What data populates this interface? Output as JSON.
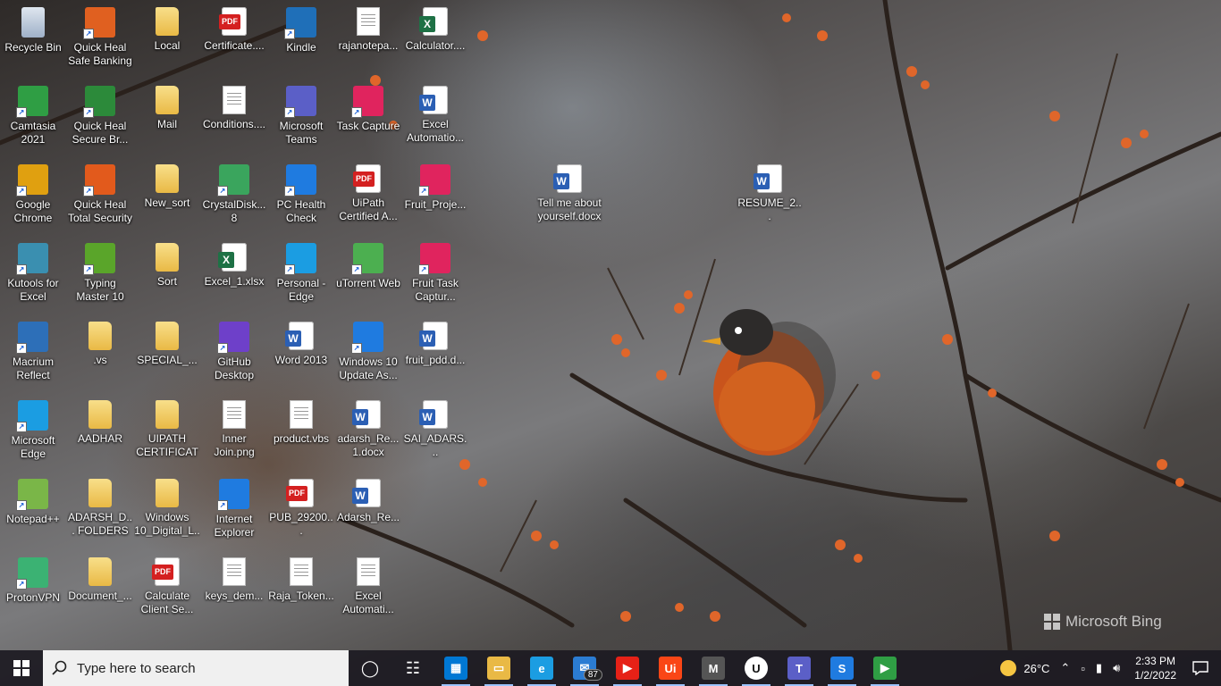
{
  "watermark": "Microsoft Bing",
  "desktop_icons": [
    {
      "label": "Recycle Bin",
      "kind": "recycle",
      "color": "#6a7fa0"
    },
    {
      "label": "Quick Heal Safe Banking",
      "kind": "app",
      "color": "#e06020"
    },
    {
      "label": "Local",
      "kind": "folder"
    },
    {
      "label": "Certificate....",
      "kind": "pdf"
    },
    {
      "label": "Kindle",
      "kind": "app",
      "color": "#1f6fb8"
    },
    {
      "label": "rajanotepa...",
      "kind": "doc"
    },
    {
      "label": "Calculator....",
      "kind": "excel"
    },
    {
      "label": "Camtasia 2021",
      "kind": "app",
      "color": "#2f9e44"
    },
    {
      "label": "Quick Heal Secure Br...",
      "kind": "app",
      "color": "#2c8a3a"
    },
    {
      "label": "Mail",
      "kind": "folder"
    },
    {
      "label": "Conditions....",
      "kind": "doc"
    },
    {
      "label": "Microsoft Teams",
      "kind": "app",
      "color": "#5b5fc7"
    },
    {
      "label": "Task Capture",
      "kind": "app",
      "color": "#e0245e"
    },
    {
      "label": "Excel Automatio...",
      "kind": "word"
    },
    {
      "label": "Google Chrome",
      "kind": "app",
      "color": "#e0a010"
    },
    {
      "label": "Quick Heal Total Security",
      "kind": "app",
      "color": "#e25a1c"
    },
    {
      "label": "New_sort",
      "kind": "folder"
    },
    {
      "label": "CrystalDisk... 8",
      "kind": "app",
      "color": "#3aa55d"
    },
    {
      "label": "PC Health Check",
      "kind": "app",
      "color": "#1f7be0"
    },
    {
      "label": "UiPath Certified A...",
      "kind": "pdf"
    },
    {
      "label": "Fruit_Proje...",
      "kind": "app",
      "color": "#e0245e"
    },
    {
      "label": "Kutools for Excel",
      "kind": "app",
      "color": "#3a8fb0"
    },
    {
      "label": "Typing Master 10",
      "kind": "app",
      "color": "#5aa52a"
    },
    {
      "label": "Sort",
      "kind": "folder"
    },
    {
      "label": "Excel_1.xlsx",
      "kind": "excel"
    },
    {
      "label": "Personal - Edge",
      "kind": "app",
      "color": "#1b9de2"
    },
    {
      "label": "uTorrent Web",
      "kind": "app",
      "color": "#4caf50"
    },
    {
      "label": "Fruit Task Captur...",
      "kind": "app",
      "color": "#e0245e"
    },
    {
      "label": "Macrium Reflect",
      "kind": "app",
      "color": "#2d6fb8"
    },
    {
      "label": ".vs",
      "kind": "folder"
    },
    {
      "label": "SPECIAL_...",
      "kind": "folder"
    },
    {
      "label": "GitHub Desktop",
      "kind": "app",
      "color": "#6e40c9"
    },
    {
      "label": "Word 2013",
      "kind": "word"
    },
    {
      "label": "Windows 10 Update As...",
      "kind": "app",
      "color": "#1f7be0"
    },
    {
      "label": "fruit_pdd.d...",
      "kind": "word"
    },
    {
      "label": "Microsoft Edge",
      "kind": "app",
      "color": "#1b9de2"
    },
    {
      "label": "AADHAR",
      "kind": "folder"
    },
    {
      "label": "UIPATH CERTIFICATES",
      "kind": "folder"
    },
    {
      "label": "Inner Join.png",
      "kind": "doc"
    },
    {
      "label": "product.vbs",
      "kind": "doc"
    },
    {
      "label": "adarsh_Re... 1.docx",
      "kind": "word"
    },
    {
      "label": "SAI_ADARS...",
      "kind": "word"
    },
    {
      "label": "Notepad++",
      "kind": "app",
      "color": "#7ab648"
    },
    {
      "label": "ADARSH_D... FOLDERS",
      "kind": "folder"
    },
    {
      "label": "Windows 10_Digital_L...",
      "kind": "folder"
    },
    {
      "label": "Internet Explorer",
      "kind": "app",
      "color": "#1f7be0"
    },
    {
      "label": "PUB_29200...",
      "kind": "pdf"
    },
    {
      "label": "Adarsh_Re...",
      "kind": "word"
    },
    {
      "label": "ProtonVPN",
      "kind": "app",
      "color": "#3bb273"
    },
    {
      "label": "Document_...",
      "kind": "folder"
    },
    {
      "label": "Calculate Client Se...",
      "kind": "pdf"
    },
    {
      "label": "keys_dem...",
      "kind": "doc"
    },
    {
      "label": "Raja_Token...",
      "kind": "doc"
    },
    {
      "label": "Excel Automati...",
      "kind": "doc"
    },
    {
      "label": "Tell me about yourself.docx",
      "kind": "word"
    },
    {
      "label": "RESUME_2...",
      "kind": "word"
    }
  ],
  "taskbar": {
    "search_placeholder": "Type here to search",
    "apps": [
      {
        "name": "task-view",
        "glyph": "◯",
        "color": "transparent"
      },
      {
        "name": "timeline",
        "glyph": "☷",
        "color": "transparent"
      },
      {
        "name": "microsoft-store",
        "glyph": "▦",
        "color": "#0078d4"
      },
      {
        "name": "file-explorer",
        "glyph": "▭",
        "color": "#e9b945"
      },
      {
        "name": "edge",
        "glyph": "e",
        "color": "#1b9de2"
      },
      {
        "name": "mail",
        "glyph": "✉",
        "color": "#2b7cd3",
        "badge": "87"
      },
      {
        "name": "youtube",
        "glyph": "▶",
        "color": "#e62117"
      },
      {
        "name": "uipath",
        "glyph": "Ui",
        "color": "#fa4616"
      },
      {
        "name": "app-m",
        "glyph": "M",
        "color": "#555555"
      },
      {
        "name": "app-u",
        "glyph": "U",
        "color": "#ffffff"
      },
      {
        "name": "teams",
        "glyph": "T",
        "color": "#5b5fc7"
      },
      {
        "name": "app-s",
        "glyph": "S",
        "color": "#1f7be0"
      },
      {
        "name": "camtasia-player",
        "glyph": "▶",
        "color": "#2f9e44"
      }
    ],
    "weather": "26°C",
    "time": "2:33 PM",
    "date": "1/2/2022"
  }
}
